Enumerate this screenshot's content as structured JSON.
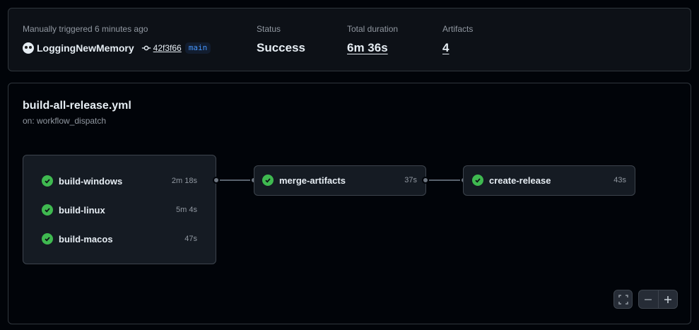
{
  "run": {
    "trigger_text": "Manually triggered 6 minutes ago",
    "actor": "LoggingNewMemory",
    "commit_sha": "42f3f66",
    "branch": "main",
    "status_label": "Status",
    "status_value": "Success",
    "duration_label": "Total duration",
    "duration_value": "6m 36s",
    "artifacts_label": "Artifacts",
    "artifacts_value": "4"
  },
  "workflow": {
    "name": "build-all-release.yml",
    "trigger": "on: workflow_dispatch"
  },
  "jobs": {
    "build_group": [
      {
        "name": "build-windows",
        "duration": "2m 18s",
        "status": "success"
      },
      {
        "name": "build-linux",
        "duration": "5m 4s",
        "status": "success"
      },
      {
        "name": "build-macos",
        "duration": "47s",
        "status": "success"
      }
    ],
    "merge": {
      "name": "merge-artifacts",
      "duration": "37s",
      "status": "success"
    },
    "release": {
      "name": "create-release",
      "duration": "43s",
      "status": "success"
    }
  },
  "controls": {
    "fullscreen_icon": "fullscreen-icon",
    "zoom_out_icon": "minus-icon",
    "zoom_in_icon": "plus-icon"
  },
  "colors": {
    "success": "#3fb950",
    "branch_text": "#4493f8"
  }
}
